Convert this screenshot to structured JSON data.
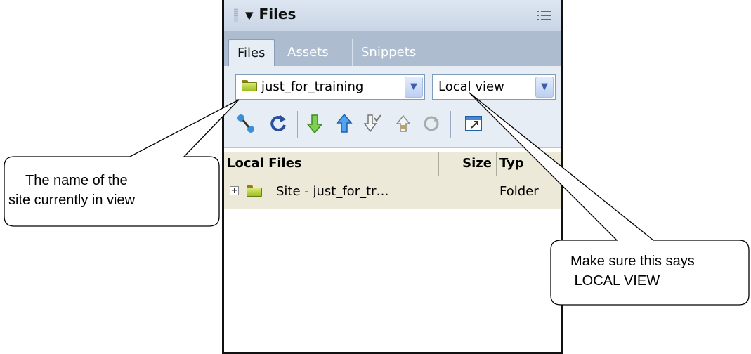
{
  "panel": {
    "title": "Files",
    "tabs": [
      {
        "label": "Files",
        "active": true
      },
      {
        "label": "Assets",
        "active": false
      },
      {
        "label": "Snippets",
        "active": false
      }
    ],
    "site_select": {
      "value": "just_for_training"
    },
    "view_select": {
      "value": "Local view"
    },
    "toolbar_icons": [
      "connect-icon",
      "refresh-icon",
      "get-files-icon",
      "put-files-icon",
      "check-out-icon",
      "check-in-icon",
      "synchronize-icon",
      "expand-icon"
    ],
    "columns": {
      "name": "Local Files",
      "size": "Size",
      "type": "Typ"
    },
    "rows": [
      {
        "name": "Site - just_for_tr…",
        "size": "",
        "type": "Folder"
      }
    ]
  },
  "callouts": {
    "left": {
      "line1": "The name of the",
      "line2": "site currently in view"
    },
    "right": {
      "line1": "Make sure this says",
      "line2": " LOCAL VIEW"
    }
  },
  "colors": {
    "title_bg": "#c9d5e5",
    "tab_bg": "#aebcd0",
    "toolbar_bg": "#e6edf5",
    "list_header_bg": "#ece9d8",
    "folder_green": "#9fbe1e"
  }
}
